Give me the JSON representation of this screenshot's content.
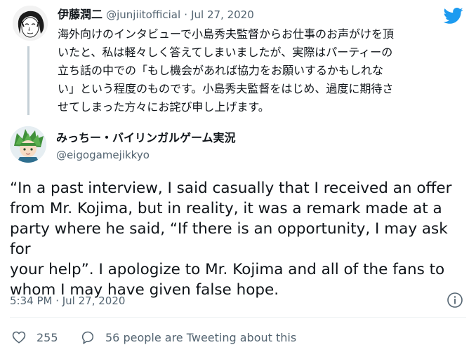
{
  "parent_tweet": {
    "name": "伊藤潤二",
    "handle": "@junjiitofficial",
    "separator": "·",
    "date": "Jul 27, 2020",
    "lines": [
      "海外向けのインタビューで小島秀夫監督からお仕事のお声がけを頂",
      "いたと、私は軽々しく答えてしまいましたが、実際はパーティーの",
      "立ち話の中での「もし機会があれば協力をお願いするかもしれな",
      "い」という程度のものです。小島秀夫監督をはじめ、過度に期待さ",
      "せてしまった方々にお詫び申し上げます。"
    ]
  },
  "main_tweet": {
    "name": "みっちー・バイリンガルゲーム実況",
    "handle": "@eigogamejikkyo",
    "lines": [
      "“In a past interview, I said casually that I received an offer",
      "from Mr. Kojima, but in reality, it was a remark made at a",
      "party where he said, “If there is an opportunity, I may ask for",
      "your help”. I apologize to Mr. Kojima and all of the fans to",
      "whom I may have given false hope."
    ],
    "timestamp": "5:34 PM · Jul 27, 2020"
  },
  "actions": {
    "likes": "255",
    "people_label": "56 people are Tweeting about this"
  },
  "colors": {
    "brand": "#1d9bf0",
    "text": "#0f1419",
    "muted": "#536471",
    "thread_line": "#c4cfd6"
  },
  "icons": {
    "bird": "twitter-bird-icon",
    "info": "info-icon",
    "heart": "heart-icon",
    "people": "speech-bubble-icon"
  }
}
